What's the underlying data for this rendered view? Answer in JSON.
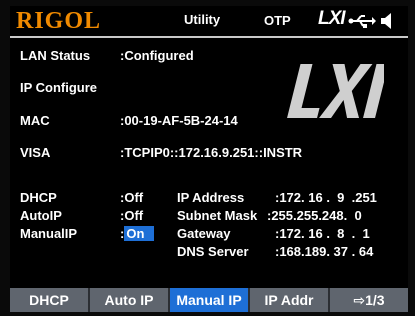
{
  "header": {
    "brand": "RIGOL",
    "mode": "Utility",
    "status": "OTP",
    "lxi_badge": "LXI",
    "icons": [
      "usb-icon",
      "speaker-icon"
    ]
  },
  "info": [
    {
      "label": "LAN Status",
      "value": ":Configured"
    },
    {
      "label": "IP Configure",
      "value": ""
    },
    {
      "label": "MAC",
      "value": ":00-19-AF-5B-24-14"
    },
    {
      "label": "VISA",
      "value": ":TCPIP0::172.16.9.251::INSTR"
    }
  ],
  "modes": [
    {
      "label": "DHCP",
      "value": ":Off"
    },
    {
      "label": "AutoIP",
      "value": ":Off"
    },
    {
      "label": "ManualIP",
      "value_prefix": ":",
      "value": "On"
    }
  ],
  "network": [
    {
      "label": "IP Address",
      "value": ":172. 16 .  9  .251"
    },
    {
      "label": "Subnet Mask",
      "value": ":255.255.248.  0"
    },
    {
      "label": "Gateway",
      "value": ":172. 16 .  8  .  1"
    },
    {
      "label": "DNS Server",
      "value": ":168.189. 37 . 64"
    }
  ],
  "softkeys": [
    {
      "label": "DHCP",
      "active": false
    },
    {
      "label": "Auto IP",
      "active": false
    },
    {
      "label": "Manual IP",
      "active": true
    },
    {
      "label": "IP Addr",
      "active": false
    },
    {
      "label": "⇨1/3",
      "active": false
    }
  ],
  "colors": {
    "brand": "#f08a00",
    "highlight": "#1e6fd6",
    "softkey_bg": "#5f656e"
  }
}
